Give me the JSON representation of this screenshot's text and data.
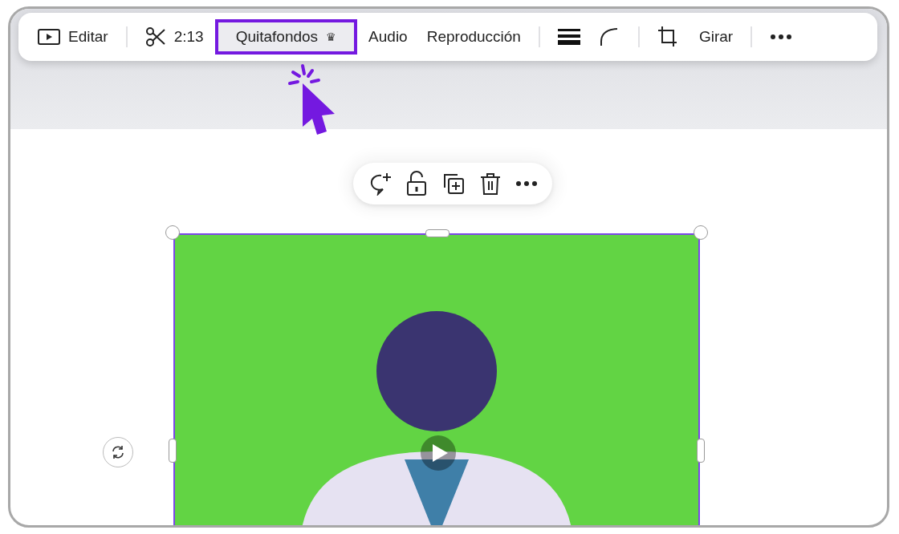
{
  "toolbar": {
    "items": [
      {
        "kind": "button",
        "label": "Editar",
        "highlighted": false
      },
      {
        "kind": "divider"
      },
      {
        "kind": "button",
        "label": "2:13",
        "highlighted": false
      },
      {
        "kind": "button",
        "label": "Quitafondos",
        "badge": "♛",
        "highlighted": true
      },
      {
        "kind": "button",
        "label": "Audio",
        "highlighted": false
      },
      {
        "kind": "button",
        "label": "Reproducción",
        "highlighted": false
      },
      {
        "kind": "divider"
      },
      {
        "kind": "icon"
      },
      {
        "kind": "icon"
      },
      {
        "kind": "divider"
      },
      {
        "kind": "icon"
      },
      {
        "kind": "button",
        "label": "Girar",
        "highlighted": false
      },
      {
        "kind": "divider"
      },
      {
        "kind": "icon"
      }
    ]
  },
  "video": {
    "playing": false
  }
}
